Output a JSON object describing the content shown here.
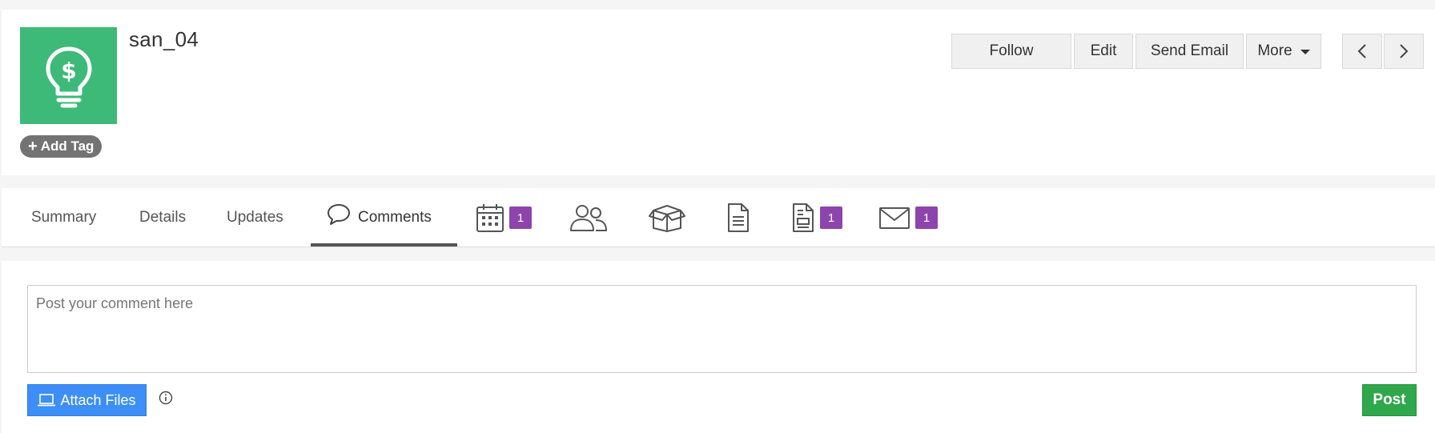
{
  "record": {
    "name": "san_04",
    "avatar_icon": "lightbulb-dollar-icon",
    "avatar_color": "#3dba78",
    "add_tag_label": "Add Tag"
  },
  "actions": {
    "follow": "Follow",
    "edit": "Edit",
    "send_email": "Send Email",
    "more": "More"
  },
  "nav": {
    "prev_icon": "chevron-left-icon",
    "next_icon": "chevron-right-icon"
  },
  "tabs": [
    {
      "label": "Summary"
    },
    {
      "label": "Details"
    },
    {
      "label": "Updates"
    },
    {
      "label": "Comments",
      "icon": "comment-icon",
      "active": true
    }
  ],
  "icon_tabs": [
    {
      "icon": "calendar-icon",
      "badge": "1"
    },
    {
      "icon": "users-icon",
      "badge": ""
    },
    {
      "icon": "box-icon",
      "badge": ""
    },
    {
      "icon": "document-icon",
      "badge": ""
    },
    {
      "icon": "invoice-icon",
      "badge": "1"
    },
    {
      "icon": "envelope-icon",
      "badge": "1"
    }
  ],
  "comment": {
    "placeholder": "Post your comment here",
    "value": "",
    "attach_label": "Attach Files",
    "post_label": "Post"
  },
  "colors": {
    "badge": "#8e44ad",
    "attach_button": "#3d8ef7",
    "post_button": "#2ea84a"
  }
}
